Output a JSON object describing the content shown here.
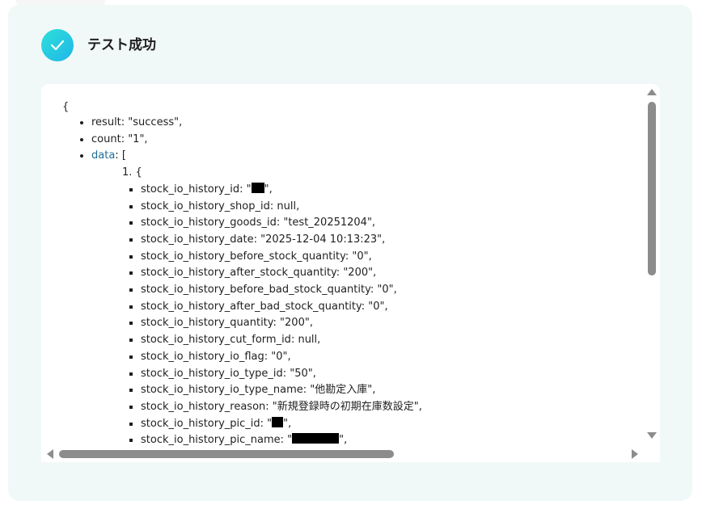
{
  "header": {
    "title": "テスト成功",
    "icon": "check-icon",
    "icon_color": "#ffffff",
    "accent_gradient": [
      "#2ee0d9",
      "#1fb6e8"
    ]
  },
  "json_view": {
    "open_brace": "{",
    "top_fields": [
      {
        "key": "result",
        "value": "\"success\","
      },
      {
        "key": "count",
        "value": "\"1\","
      }
    ],
    "data_key": "data",
    "data_open": "[",
    "item_index": "1.",
    "item_open": "{",
    "record": [
      {
        "key": "stock_io_history_id",
        "before": "\"",
        "redacted": true,
        "redact_width": 16,
        "after": "\","
      },
      {
        "key": "stock_io_history_shop_id",
        "value": "null,"
      },
      {
        "key": "stock_io_history_goods_id",
        "value": "\"test_20251204\","
      },
      {
        "key": "stock_io_history_date",
        "value": "\"2025-12-04 10:13:23\","
      },
      {
        "key": "stock_io_history_before_stock_quantity",
        "value": "\"0\","
      },
      {
        "key": "stock_io_history_after_stock_quantity",
        "value": "\"200\","
      },
      {
        "key": "stock_io_history_before_bad_stock_quantity",
        "value": "\"0\","
      },
      {
        "key": "stock_io_history_after_bad_stock_quantity",
        "value": "\"0\","
      },
      {
        "key": "stock_io_history_quantity",
        "value": "\"200\","
      },
      {
        "key": "stock_io_history_cut_form_id",
        "value": "null,"
      },
      {
        "key": "stock_io_history_io_flag",
        "value": "\"0\","
      },
      {
        "key": "stock_io_history_io_type_id",
        "value": "\"50\","
      },
      {
        "key": "stock_io_history_io_type_name",
        "value": "\"他勘定入庫\","
      },
      {
        "key": "stock_io_history_reason",
        "value": "\"新規登録時の初期在庫数設定\","
      },
      {
        "key": "stock_io_history_pic_id",
        "before": "\"",
        "redacted": true,
        "redact_width": 14,
        "after": "\","
      },
      {
        "key": "stock_io_history_pic_name",
        "before": "\"",
        "redacted": true,
        "redact_width": 58,
        "after": "\","
      }
    ]
  },
  "colors": {
    "card_bg": "#f1f9f8",
    "link_key": "#1f6f9a",
    "scrollbar": "#8c8c8c"
  }
}
